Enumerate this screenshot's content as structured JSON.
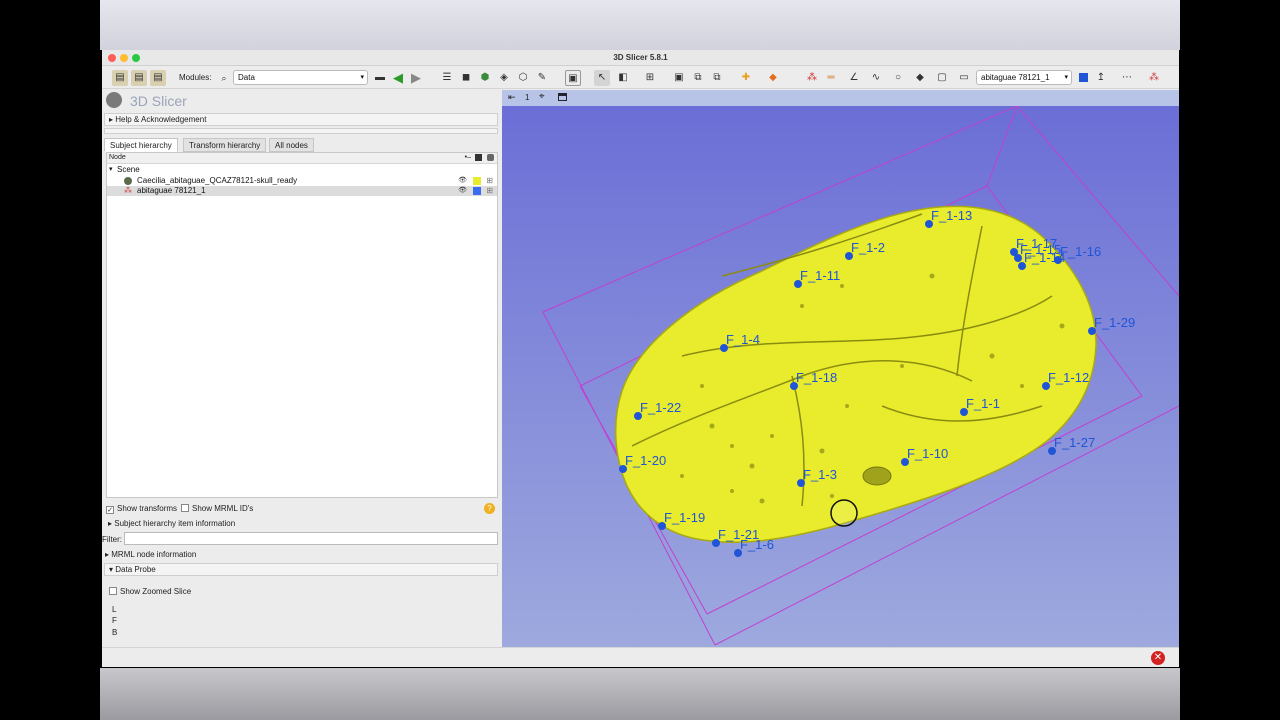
{
  "window": {
    "title": "3D Slicer 5.8.1"
  },
  "toolbar": {
    "modules_label": "Modules:",
    "module_selected": "Data",
    "node_selector": "abitaguae 78121_1"
  },
  "app": {
    "name": "3D Slicer"
  },
  "sections": {
    "help": "Help & Acknowledgement",
    "subject_item_info": "Subject hierarchy item information",
    "mrml_info": "MRML node information",
    "data_probe": "Data Probe"
  },
  "tabs": [
    "Subject hierarchy",
    "Transform hierarchy",
    "All nodes"
  ],
  "tree": {
    "header": "Node",
    "scene": "Scene",
    "rows": [
      {
        "name": "Caecilia_abitaguae_QCAZ78121-skull_ready",
        "color": "#e8ec2c"
      },
      {
        "name": "abitaguae 78121_1",
        "color": "#3b6cf0"
      }
    ]
  },
  "options": {
    "show_transforms": "Show transforms",
    "show_mrml_ids": "Show MRML ID's",
    "filter_label": "Filter:",
    "show_zoomed_slice": "Show Zoomed Slice"
  },
  "probe": {
    "lines": [
      "L",
      "F",
      "B"
    ]
  },
  "view": {
    "number": "1"
  },
  "landmarks": [
    {
      "label": "F_1-13"
    },
    {
      "label": "F_1-2"
    },
    {
      "label": "F_1-11"
    },
    {
      "label": "F_1-17"
    },
    {
      "label": "F_1-15"
    },
    {
      "label": "F_1-16"
    },
    {
      "label": "F_1-14"
    },
    {
      "label": "F_1-29"
    },
    {
      "label": "F_1-4"
    },
    {
      "label": "F_1-18"
    },
    {
      "label": "F_1-12"
    },
    {
      "label": "F_1-22"
    },
    {
      "label": "F_1-1"
    },
    {
      "label": "F_1-27"
    },
    {
      "label": "F_1-10"
    },
    {
      "label": "F_1-20"
    },
    {
      "label": "F_1-3"
    },
    {
      "label": "F_1-19"
    },
    {
      "label": "F_1-21"
    },
    {
      "label": "F_1-6"
    }
  ],
  "colors": {
    "model": "#e8ec2c",
    "landmark": "#1f55d6",
    "box": "#c040d0"
  }
}
